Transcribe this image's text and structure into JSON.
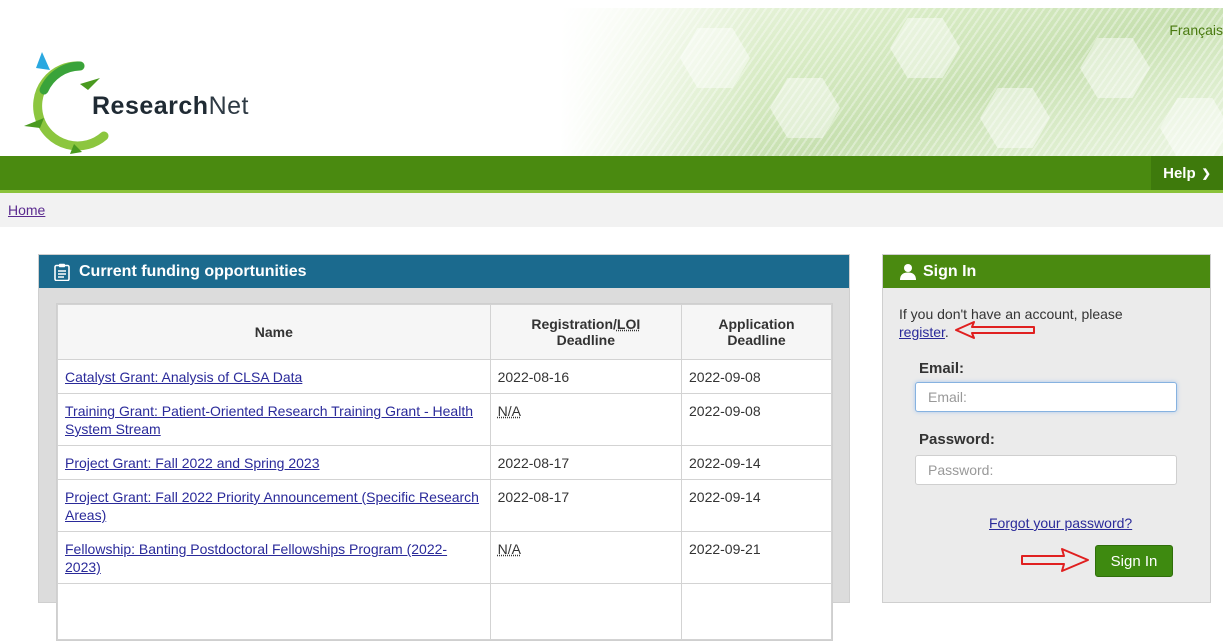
{
  "header": {
    "language_link": "Français",
    "logo_text_bold": "Research",
    "logo_text_light": "Net"
  },
  "nav": {
    "help_label": "Help"
  },
  "breadcrumb": {
    "home": "Home"
  },
  "funding": {
    "title": "Current funding opportunities",
    "columns": {
      "name": "Name",
      "registration_line1": "Registration/",
      "registration_abbr": "LOI",
      "registration_line2": "Deadline",
      "application_line1": "Application",
      "application_line2": "Deadline"
    },
    "rows": [
      {
        "name": "Catalyst Grant: Analysis of CLSA Data",
        "registration": "2022-08-16",
        "application": "2022-09-08"
      },
      {
        "name": "Training Grant: Patient-Oriented Research Training Grant - Health System Stream",
        "registration": "N/A",
        "application": "2022-09-08"
      },
      {
        "name": "Project Grant: Fall 2022 and Spring 2023",
        "registration": "2022-08-17",
        "application": "2022-09-14"
      },
      {
        "name": "Project Grant: Fall 2022 Priority Announcement (Specific Research Areas)",
        "registration": "2022-08-17",
        "application": "2022-09-14"
      },
      {
        "name": "Fellowship: Banting Postdoctoral Fellowships Program (2022-2023)",
        "registration": "N/A",
        "application": "2022-09-21"
      }
    ]
  },
  "signin": {
    "title": "Sign In",
    "intro_text": "If you don't have an account, please",
    "register_link": "register",
    "intro_end": ".",
    "email_label": "Email:",
    "email_placeholder": "Email:",
    "email_value": "",
    "password_label": "Password:",
    "password_placeholder": "Password:",
    "password_value": "",
    "forgot_link": "Forgot your password?",
    "submit_label": "Sign In"
  },
  "colors": {
    "nav_green": "#4a8a10",
    "panel_blue": "#1b6a8e",
    "annotation_red": "#e02020"
  }
}
